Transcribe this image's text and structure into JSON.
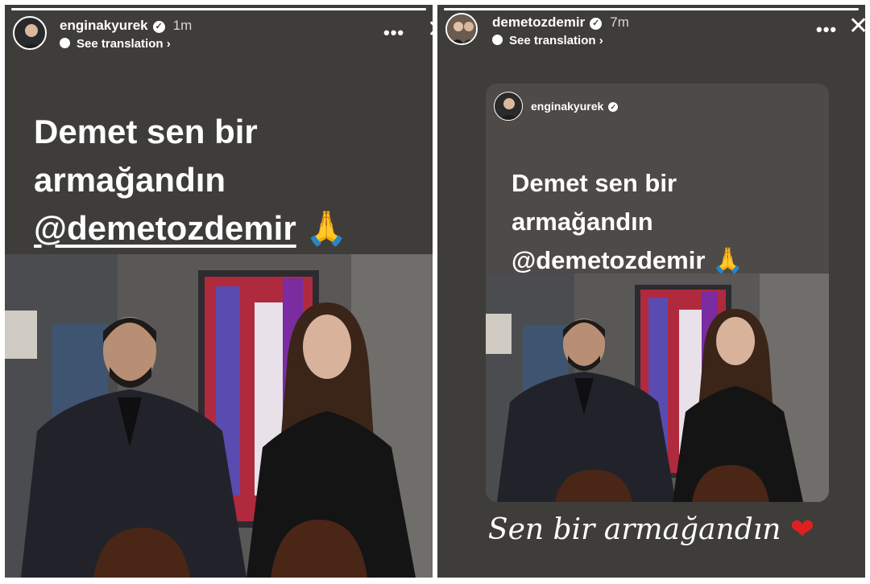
{
  "left_story": {
    "username": "enginakyurek",
    "time": "1m",
    "translation_label": "See translation ›",
    "more_label": "•••",
    "close_label": "✕",
    "message_line1": "Demet sen bir",
    "message_line2": "armağandın",
    "mention": "@demetozdemir",
    "emoji": "🙏"
  },
  "right_story": {
    "username": "demetozdemir",
    "time": "7m",
    "translation_label": "See translation ›",
    "more_label": "•••",
    "close_label": "✕",
    "reposted_user": "enginakyurek",
    "message_line1": "Demet sen bir",
    "message_line2": "armağandın",
    "mention": "@demetozdemir",
    "emoji": "🙏",
    "caption": "Sen bir armağandın",
    "heart": "❤"
  },
  "colors": {
    "story_bg": "#3f3d3a",
    "repost_card_bg": "#4d4a47",
    "heart": "#e02020"
  },
  "icons": [
    "verified-badge-icon",
    "globe-icon",
    "more-options-icon",
    "close-icon",
    "folded-hands-emoji",
    "heart-emoji"
  ]
}
